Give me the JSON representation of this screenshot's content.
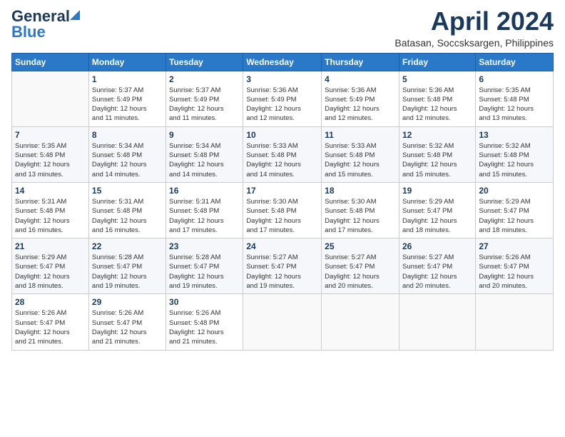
{
  "logo": {
    "general": "General",
    "blue": "Blue"
  },
  "title": {
    "month_year": "April 2024",
    "location": "Batasan, Soccsksargen, Philippines"
  },
  "weekdays": [
    "Sunday",
    "Monday",
    "Tuesday",
    "Wednesday",
    "Thursday",
    "Friday",
    "Saturday"
  ],
  "weeks": [
    [
      {
        "day": "",
        "info": ""
      },
      {
        "day": "1",
        "info": "Sunrise: 5:37 AM\nSunset: 5:49 PM\nDaylight: 12 hours\nand 11 minutes."
      },
      {
        "day": "2",
        "info": "Sunrise: 5:37 AM\nSunset: 5:49 PM\nDaylight: 12 hours\nand 11 minutes."
      },
      {
        "day": "3",
        "info": "Sunrise: 5:36 AM\nSunset: 5:49 PM\nDaylight: 12 hours\nand 12 minutes."
      },
      {
        "day": "4",
        "info": "Sunrise: 5:36 AM\nSunset: 5:49 PM\nDaylight: 12 hours\nand 12 minutes."
      },
      {
        "day": "5",
        "info": "Sunrise: 5:36 AM\nSunset: 5:48 PM\nDaylight: 12 hours\nand 12 minutes."
      },
      {
        "day": "6",
        "info": "Sunrise: 5:35 AM\nSunset: 5:48 PM\nDaylight: 12 hours\nand 13 minutes."
      }
    ],
    [
      {
        "day": "7",
        "info": "Sunrise: 5:35 AM\nSunset: 5:48 PM\nDaylight: 12 hours\nand 13 minutes."
      },
      {
        "day": "8",
        "info": "Sunrise: 5:34 AM\nSunset: 5:48 PM\nDaylight: 12 hours\nand 14 minutes."
      },
      {
        "day": "9",
        "info": "Sunrise: 5:34 AM\nSunset: 5:48 PM\nDaylight: 12 hours\nand 14 minutes."
      },
      {
        "day": "10",
        "info": "Sunrise: 5:33 AM\nSunset: 5:48 PM\nDaylight: 12 hours\nand 14 minutes."
      },
      {
        "day": "11",
        "info": "Sunrise: 5:33 AM\nSunset: 5:48 PM\nDaylight: 12 hours\nand 15 minutes."
      },
      {
        "day": "12",
        "info": "Sunrise: 5:32 AM\nSunset: 5:48 PM\nDaylight: 12 hours\nand 15 minutes."
      },
      {
        "day": "13",
        "info": "Sunrise: 5:32 AM\nSunset: 5:48 PM\nDaylight: 12 hours\nand 15 minutes."
      }
    ],
    [
      {
        "day": "14",
        "info": "Sunrise: 5:31 AM\nSunset: 5:48 PM\nDaylight: 12 hours\nand 16 minutes."
      },
      {
        "day": "15",
        "info": "Sunrise: 5:31 AM\nSunset: 5:48 PM\nDaylight: 12 hours\nand 16 minutes."
      },
      {
        "day": "16",
        "info": "Sunrise: 5:31 AM\nSunset: 5:48 PM\nDaylight: 12 hours\nand 17 minutes."
      },
      {
        "day": "17",
        "info": "Sunrise: 5:30 AM\nSunset: 5:48 PM\nDaylight: 12 hours\nand 17 minutes."
      },
      {
        "day": "18",
        "info": "Sunrise: 5:30 AM\nSunset: 5:48 PM\nDaylight: 12 hours\nand 17 minutes."
      },
      {
        "day": "19",
        "info": "Sunrise: 5:29 AM\nSunset: 5:47 PM\nDaylight: 12 hours\nand 18 minutes."
      },
      {
        "day": "20",
        "info": "Sunrise: 5:29 AM\nSunset: 5:47 PM\nDaylight: 12 hours\nand 18 minutes."
      }
    ],
    [
      {
        "day": "21",
        "info": "Sunrise: 5:29 AM\nSunset: 5:47 PM\nDaylight: 12 hours\nand 18 minutes."
      },
      {
        "day": "22",
        "info": "Sunrise: 5:28 AM\nSunset: 5:47 PM\nDaylight: 12 hours\nand 19 minutes."
      },
      {
        "day": "23",
        "info": "Sunrise: 5:28 AM\nSunset: 5:47 PM\nDaylight: 12 hours\nand 19 minutes."
      },
      {
        "day": "24",
        "info": "Sunrise: 5:27 AM\nSunset: 5:47 PM\nDaylight: 12 hours\nand 19 minutes."
      },
      {
        "day": "25",
        "info": "Sunrise: 5:27 AM\nSunset: 5:47 PM\nDaylight: 12 hours\nand 20 minutes."
      },
      {
        "day": "26",
        "info": "Sunrise: 5:27 AM\nSunset: 5:47 PM\nDaylight: 12 hours\nand 20 minutes."
      },
      {
        "day": "27",
        "info": "Sunrise: 5:26 AM\nSunset: 5:47 PM\nDaylight: 12 hours\nand 20 minutes."
      }
    ],
    [
      {
        "day": "28",
        "info": "Sunrise: 5:26 AM\nSunset: 5:47 PM\nDaylight: 12 hours\nand 21 minutes."
      },
      {
        "day": "29",
        "info": "Sunrise: 5:26 AM\nSunset: 5:47 PM\nDaylight: 12 hours\nand 21 minutes."
      },
      {
        "day": "30",
        "info": "Sunrise: 5:26 AM\nSunset: 5:48 PM\nDaylight: 12 hours\nand 21 minutes."
      },
      {
        "day": "",
        "info": ""
      },
      {
        "day": "",
        "info": ""
      },
      {
        "day": "",
        "info": ""
      },
      {
        "day": "",
        "info": ""
      }
    ]
  ]
}
